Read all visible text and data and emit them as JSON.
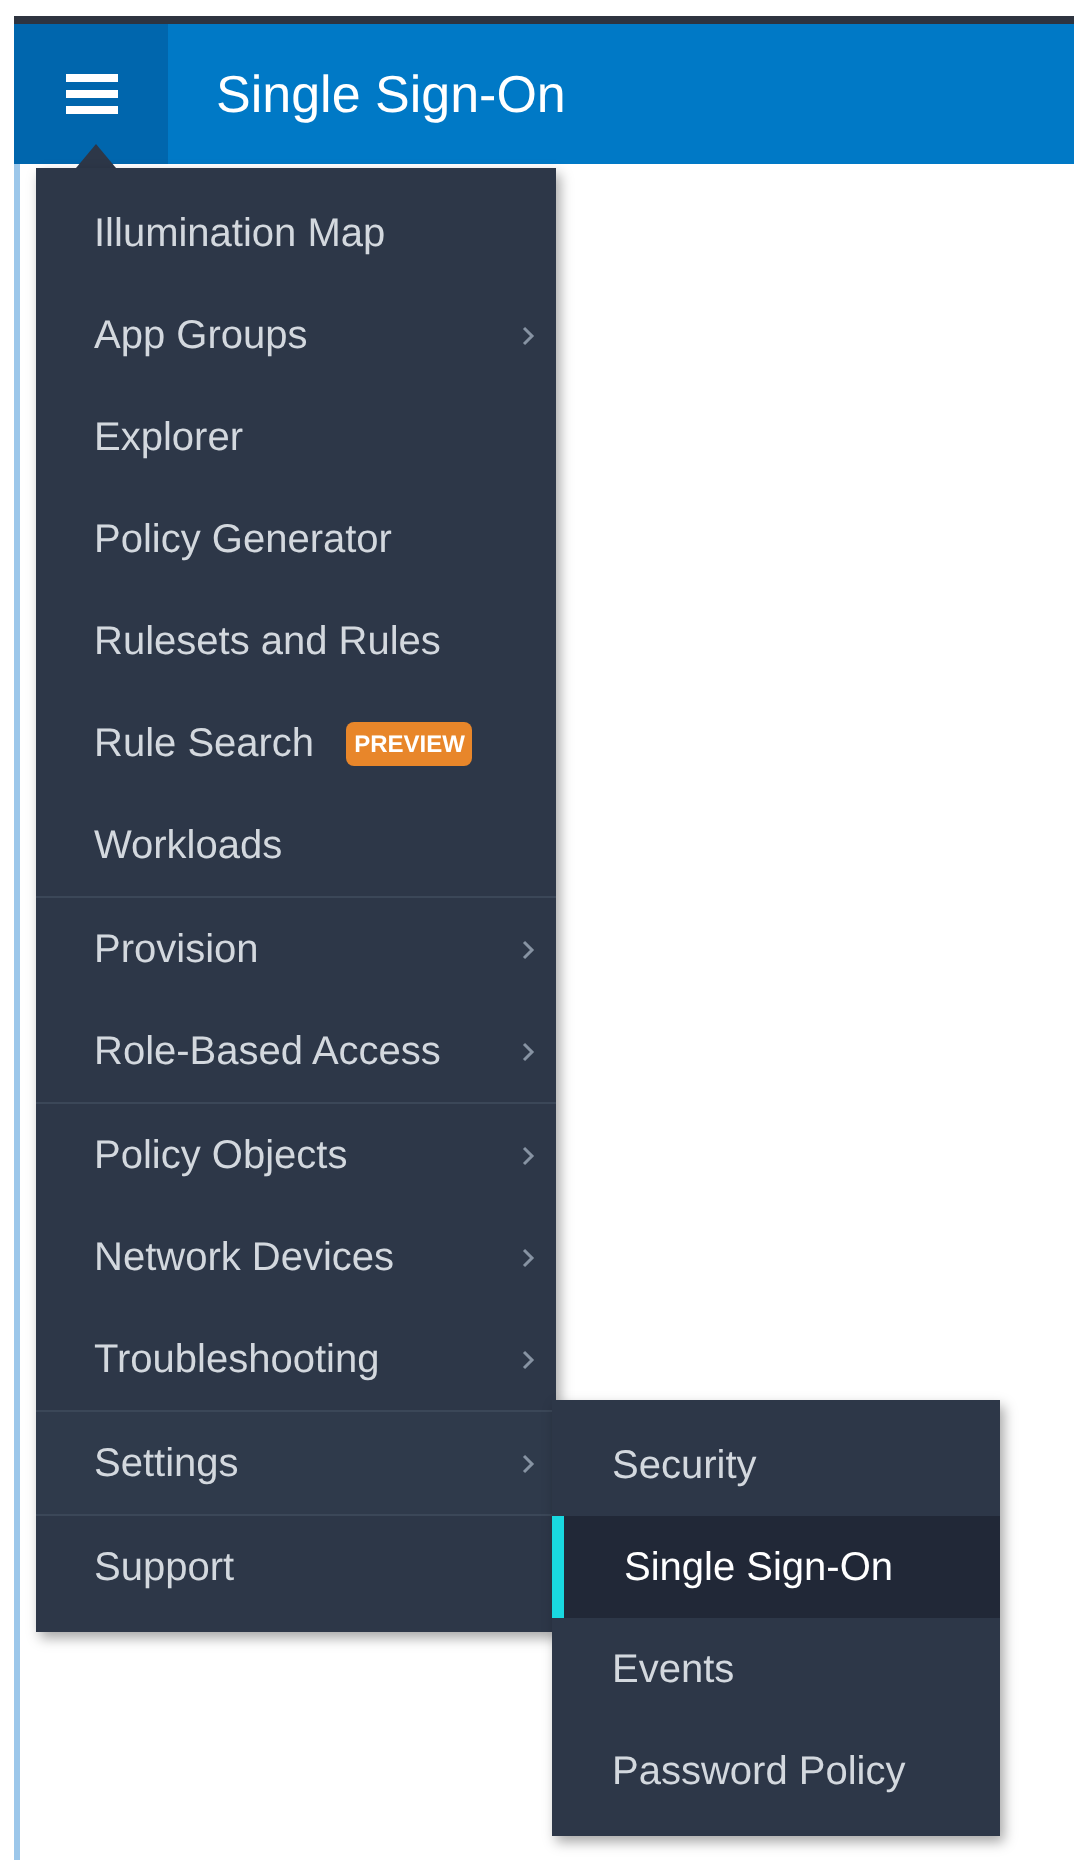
{
  "header": {
    "title": "Single Sign-On"
  },
  "menu": {
    "groups": [
      {
        "items": [
          {
            "label": "Illumination Map",
            "has_submenu": false
          },
          {
            "label": "App Groups",
            "has_submenu": true
          },
          {
            "label": "Explorer",
            "has_submenu": false
          },
          {
            "label": "Policy Generator",
            "has_submenu": false
          },
          {
            "label": "Rulesets and Rules",
            "has_submenu": false
          },
          {
            "label": "Rule Search",
            "has_submenu": false,
            "badge": "PREVIEW"
          },
          {
            "label": "Workloads",
            "has_submenu": false
          }
        ]
      },
      {
        "items": [
          {
            "label": "Provision",
            "has_submenu": true
          },
          {
            "label": "Role-Based Access",
            "has_submenu": true
          }
        ]
      },
      {
        "items": [
          {
            "label": "Policy Objects",
            "has_submenu": true
          },
          {
            "label": "Network Devices",
            "has_submenu": true
          },
          {
            "label": "Troubleshooting",
            "has_submenu": true
          }
        ]
      },
      {
        "items": [
          {
            "label": "Settings",
            "has_submenu": true,
            "expanded": true
          }
        ]
      },
      {
        "items": [
          {
            "label": "Support",
            "has_submenu": false
          }
        ]
      }
    ]
  },
  "submenu": {
    "items": [
      {
        "label": "Security",
        "selected": false
      },
      {
        "label": "Single Sign-On",
        "selected": true
      },
      {
        "label": "Events",
        "selected": false
      },
      {
        "label": "Password Policy",
        "selected": false
      }
    ]
  }
}
